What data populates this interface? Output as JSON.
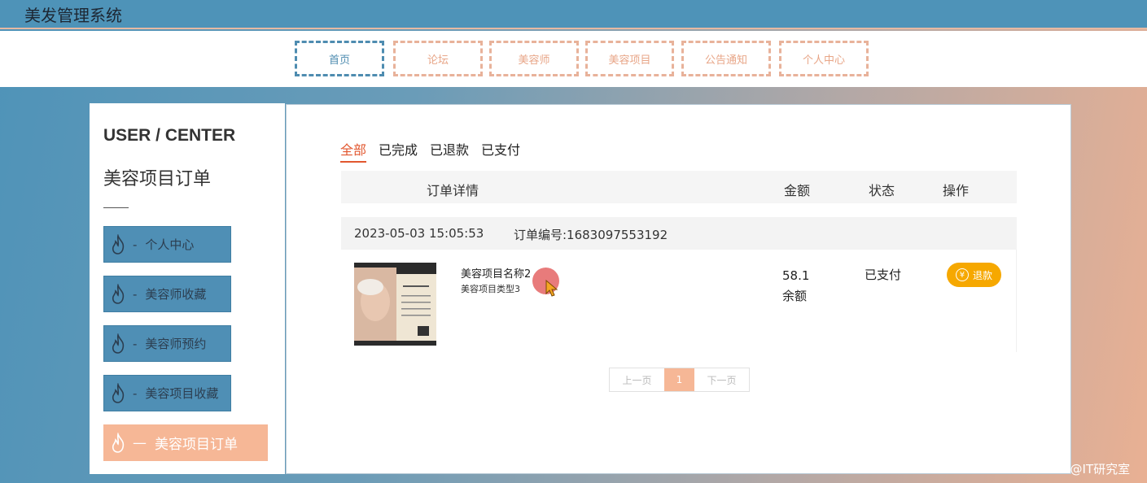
{
  "app": {
    "title": "美发管理系统"
  },
  "nav": {
    "items": [
      "首页",
      "论坛",
      "美容师",
      "美容项目",
      "公告通知",
      "个人中心"
    ],
    "active_index": 0
  },
  "sidebar": {
    "heading": "USER / CENTER",
    "subtitle": "美容项目订单",
    "items": [
      {
        "label": "个人中心",
        "prefix": "-"
      },
      {
        "label": "美容师收藏",
        "prefix": "-"
      },
      {
        "label": "美容师预约",
        "prefix": "-"
      },
      {
        "label": "美容项目收藏",
        "prefix": "-"
      },
      {
        "label": "美容项目订单",
        "prefix": "—"
      }
    ],
    "active_index": 4,
    "icon": "flame-icon"
  },
  "tabs": [
    "全部",
    "已完成",
    "已退款",
    "已支付"
  ],
  "table": {
    "headers": {
      "details": "订单详情",
      "amount": "金额",
      "status": "状态",
      "action": "操作"
    }
  },
  "order": {
    "time": "2023-05-03 15:05:53",
    "number_label": "订单编号:1683097553192",
    "product_name": "美容项目名称2",
    "product_type": "美容项目类型3",
    "amount": "58.1",
    "pay_method": "余额",
    "status": "已支付",
    "refund_label": "退款",
    "refund_icon": "¥"
  },
  "pagination": {
    "prev": "上一页",
    "current": "1",
    "next": "下一页"
  },
  "watermark": "CSDN @IT研究室",
  "colors": {
    "topbar": "#4e93b8",
    "accent": "#f6b796",
    "sidebar_item": "#4f8fb5",
    "refund": "#f6a800"
  }
}
